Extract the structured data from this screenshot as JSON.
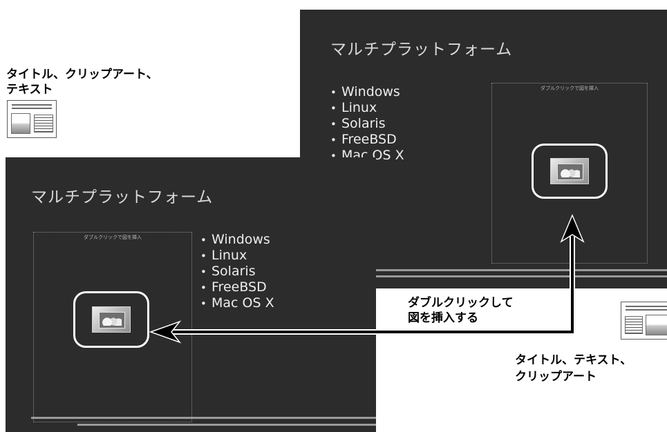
{
  "colors": {
    "slide_bg": "#2c2c2c",
    "slide_text": "#ededed",
    "annotation_text": "#000000",
    "arrow": "#000000"
  },
  "back_slide": {
    "title": "マルチプラットフォーム",
    "bullets": [
      "Windows",
      "Linux",
      "Solaris",
      "FreeBSD",
      "Mac OS X"
    ],
    "placeholder_label": "ダブルクリックで図を挿入"
  },
  "front_slide": {
    "title": "マルチプラットフォーム",
    "bullets": [
      "Windows",
      "Linux",
      "Solaris",
      "FreeBSD",
      "Mac OS X"
    ],
    "placeholder_label": "ダブルクリックで図を挿入"
  },
  "annotations": {
    "layout_left": {
      "line1": "タイトル、クリップアート、",
      "line2": "テキスト",
      "icon": "title-clipart-text-layout-icon"
    },
    "layout_right": {
      "line1": "タイトル、テキスト、",
      "line2": "クリップアート",
      "icon": "title-text-clipart-layout-icon"
    },
    "instruction": {
      "line1": "ダブルクリックして",
      "line2": "図を挿入する"
    }
  }
}
